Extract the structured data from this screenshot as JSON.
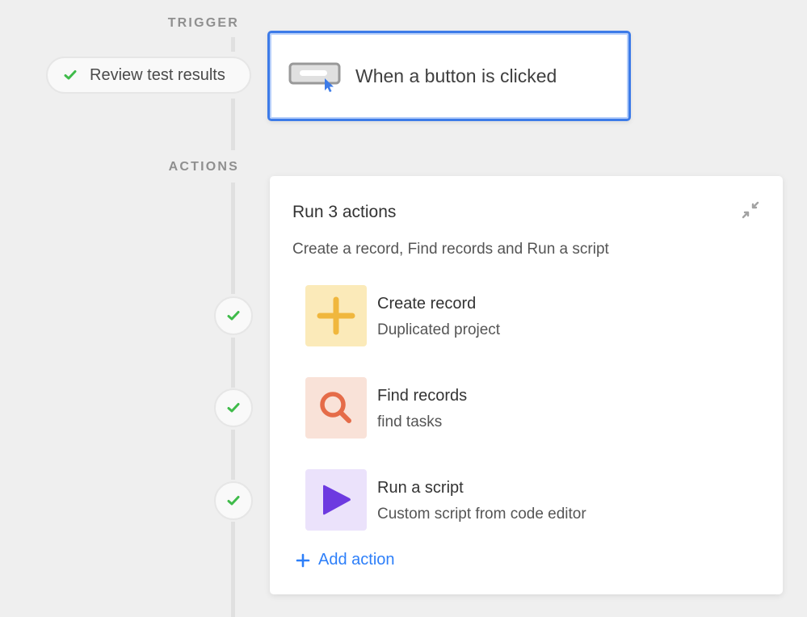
{
  "trigger": {
    "section_label": "TRIGGER",
    "pill_label": "Review test results",
    "pill_status": "success",
    "card_label": "When a button is clicked",
    "card_icon": "button-click-icon"
  },
  "actions": {
    "section_label": "ACTIONS",
    "title": "Run 3 actions",
    "subtitle": "Create a record, Find records and Run a script",
    "collapse_icon": "collapse-icon",
    "items": [
      {
        "name": "Create record",
        "description": "Duplicated project",
        "icon": "plus-icon",
        "icon_color": "#f0b73d",
        "bg_color": "#fbeab9",
        "status": "success"
      },
      {
        "name": "Find records",
        "description": "find tasks",
        "icon": "search-icon",
        "icon_color": "#e56c49",
        "bg_color": "#f9e2d8",
        "status": "success"
      },
      {
        "name": "Run a script",
        "description": "Custom script from code editor",
        "icon": "play-icon",
        "icon_color": "#6d3ae0",
        "bg_color": "#ebe2fb",
        "status": "success"
      }
    ],
    "add_action_label": "Add action"
  },
  "colors": {
    "accent": "#2d7ff9",
    "selected_border": "#3d7be8",
    "success": "#3fbb4a"
  }
}
